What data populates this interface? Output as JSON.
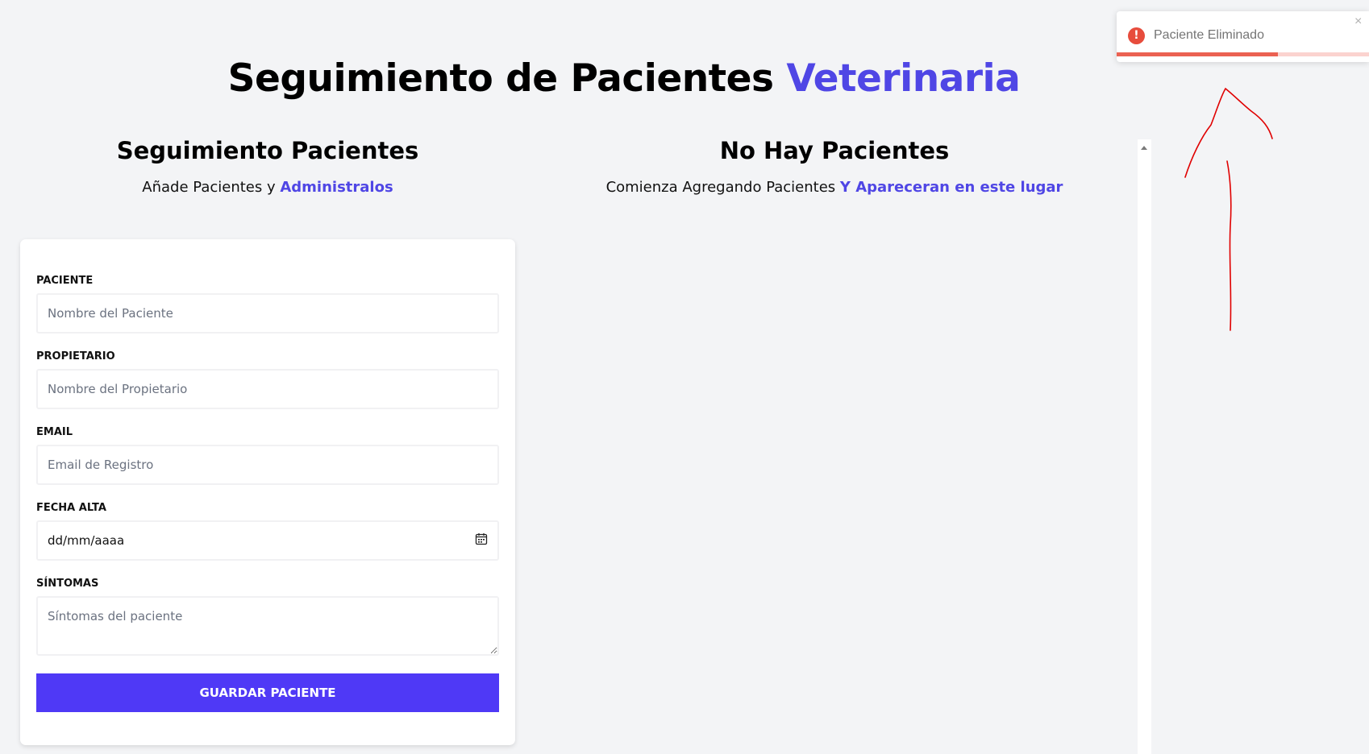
{
  "header": {
    "title_main": "Seguimiento de Pacientes",
    "title_accent": "Veterinaria"
  },
  "form_section": {
    "title": "Seguimiento Pacientes",
    "subtitle_plain": "Añade Pacientes y",
    "subtitle_accent": "Administralos"
  },
  "list_section": {
    "title": "No Hay Pacientes",
    "subtitle_plain": "Comienza Agregando Pacientes",
    "subtitle_accent": "Y Apareceran en este lugar"
  },
  "form": {
    "paciente_label": "PACIENTE",
    "paciente_placeholder": "Nombre del Paciente",
    "propietario_label": "PROPIETARIO",
    "propietario_placeholder": "Nombre del Propietario",
    "email_label": "EMAIL",
    "email_placeholder": "Email de Registro",
    "fecha_label": "FECHA ALTA",
    "fecha_value": "dd/mm/aaaa",
    "sintomas_label": "SÍNTOMAS",
    "sintomas_placeholder": "Síntomas del paciente",
    "submit_label": "GUARDAR PACIENTE"
  },
  "toast": {
    "message": "Paciente Eliminado",
    "icon_symbol": "!",
    "close_symbol": "×",
    "type": "error",
    "progress_fraction": 0.64,
    "color": "#e74c3c"
  },
  "colors": {
    "accent": "#4f46e5",
    "button": "#4f39f6",
    "background": "#f3f4f6",
    "annotation": "#e00000"
  },
  "icons": {
    "date_picker": "calendar-icon",
    "toast": "error-icon",
    "close": "close-icon"
  }
}
